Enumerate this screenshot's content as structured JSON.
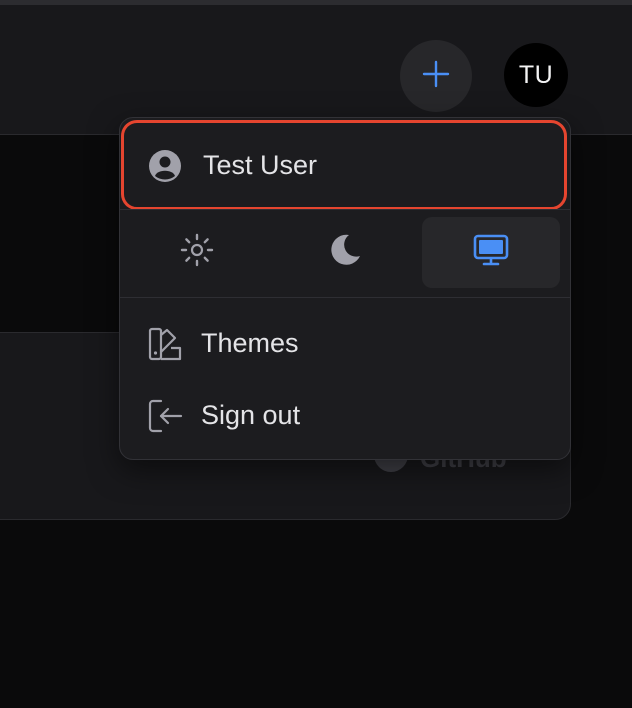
{
  "header": {
    "add_icon": "plus-icon",
    "avatar_initials": "TU"
  },
  "background_card": {
    "link_text": "GitHub",
    "link_icon": "github-icon"
  },
  "menu": {
    "user_name": "Test User",
    "user_icon": "user-circle-icon",
    "theme_options": [
      {
        "icon": "sun-icon",
        "active": false
      },
      {
        "icon": "moon-icon",
        "active": false
      },
      {
        "icon": "monitor-icon",
        "active": true
      }
    ],
    "items": [
      {
        "label": "Themes",
        "icon": "palette-icon"
      },
      {
        "label": "Sign out",
        "icon": "sign-out-icon"
      }
    ]
  },
  "colors": {
    "accent": "#4a8ff5",
    "highlight": "#e5452f",
    "menu_bg": "#1c1c1f",
    "text": "#e4e4e7",
    "icon": "#a1a1aa"
  }
}
